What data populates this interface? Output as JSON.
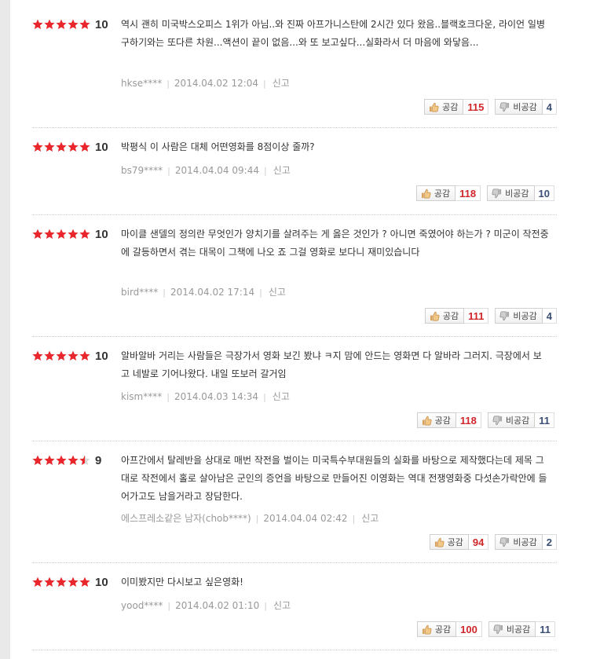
{
  "colors": {
    "star": "#e8262b",
    "star_empty": "#d9d9d9",
    "agree_count": "#d0262a",
    "disagree_count": "#3a4e75"
  },
  "labels": {
    "agree": "공감",
    "disagree": "비공감",
    "report": "신고"
  },
  "reviews": [
    {
      "rating": 5,
      "score": "10",
      "text": "역시 괜히 미국박스오피스 1위가 아님..와 진짜 아프가니스탄에 2시간 있다 왔음..블랙호크다운, 라이언 일병 구하기와는 또다른 차원...액션이 끝이 없음...와 또 보고싶다...실화라서 더 마음에 와닿음...",
      "user": "hkse****",
      "date": "2014.04.02 12:04",
      "agree": "115",
      "disagree": "4"
    },
    {
      "rating": 5,
      "score": "10",
      "text": "박평식 이 사람은 대체 어떤영화를 8점이상 줄까?",
      "user": "bs79****",
      "date": "2014.04.04 09:44",
      "agree": "118",
      "disagree": "10"
    },
    {
      "rating": 5,
      "score": "10",
      "text": "마이클 샌델의 정의란 무엇인가 양치기를 살려주는 게 옳은 것인가 ? 아니면 죽였어야 하는가 ? 미군이 작전중에 갈등하면서 겪는 대목이 그책에 나오 죠 그걸 영화로 보다니 재미있습니다",
      "user": "bird****",
      "date": "2014.04.02 17:14",
      "agree": "111",
      "disagree": "4"
    },
    {
      "rating": 5,
      "score": "10",
      "text": "알바알바 거리는 사람들은 극장가서 영화 보긴 봤냐 ㅋ지 맘에 안드는 영화면 다 알바라 그러지. 극장에서 보고 네발로 기어나왔다. 내일 또보러 갈거임",
      "user": "kism****",
      "date": "2014.04.03 14:34",
      "agree": "118",
      "disagree": "11"
    },
    {
      "rating": 4.5,
      "score": "9",
      "text": "아프간에서 탈레반을 상대로 매번 작전을 벌이는 미국특수부대원들의 실화를 바탕으로 제작했다는데 제목 그대로 작전에서 홀로 살아남은 군인의 증언을 바탕으로 만들어진 이영화는 역대 전쟁영화중 다섯손가락안에 들어가고도 남을거라고 장담한다.",
      "user": "에스프레소같은 남자(chob****)",
      "date": "2014.04.04 02:42",
      "agree": "94",
      "disagree": "2"
    },
    {
      "rating": 5,
      "score": "10",
      "text": "이미봤지만 다시보고 싶은영화!",
      "user": "yood****",
      "date": "2014.04.02 01:10",
      "agree": "100",
      "disagree": "11"
    }
  ]
}
